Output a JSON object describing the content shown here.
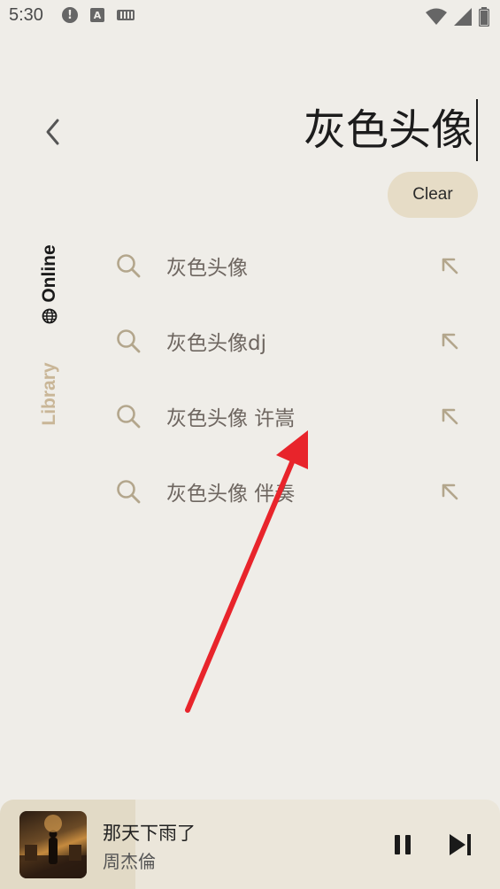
{
  "status": {
    "time": "5:30",
    "icons": [
      "alert-icon",
      "a-box-icon",
      "keyboard-icon",
      "wifi-icon",
      "signal-icon",
      "battery-icon"
    ]
  },
  "search": {
    "query": "灰色头像",
    "clear_label": "Clear"
  },
  "sidebar": {
    "online_label": "Online",
    "library_label": "Library"
  },
  "suggestions": [
    {
      "text": "灰色头像"
    },
    {
      "text": "灰色头像dj"
    },
    {
      "text": "灰色头像 许嵩"
    },
    {
      "text": "灰色头像 伴奏"
    }
  ],
  "player": {
    "title": "那天下雨了",
    "artist": "周杰倫",
    "progress": 0.27
  },
  "colors": {
    "background": "#efede8",
    "accent": "#e6dcc6",
    "annotation_arrow": "#e8242b",
    "library_tab": "#c9b697"
  }
}
